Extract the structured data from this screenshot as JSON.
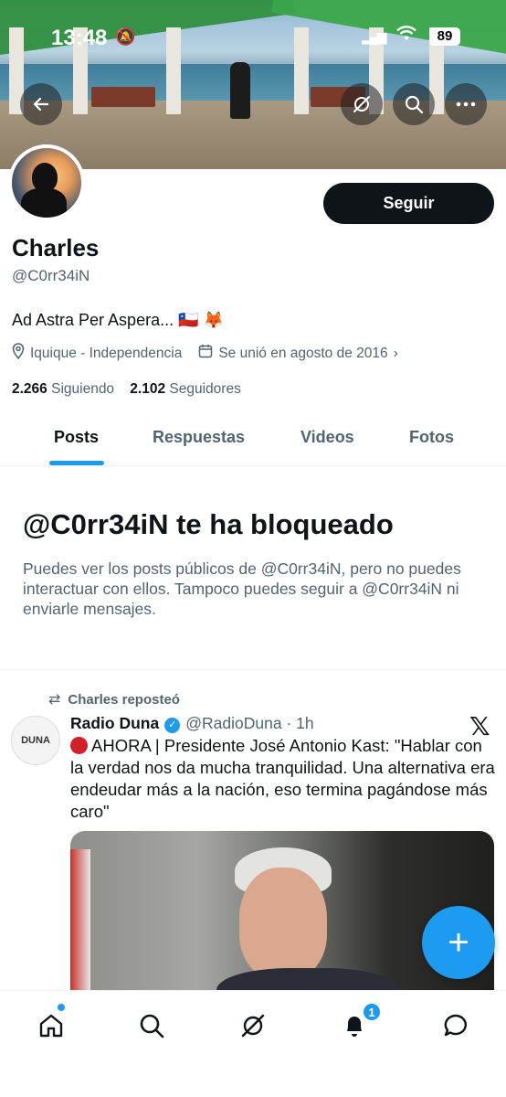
{
  "status_bar": {
    "time": "13:48",
    "battery": "89"
  },
  "profile": {
    "name": "Charles",
    "handle": "@C0rr34iN",
    "bio": "Ad Astra Per Aspera... 🇨🇱 🦊",
    "location": "Iquique - Independencia",
    "joined": "Se unió en agosto de 2016",
    "following_count": "2.266",
    "following_label": "Siguiendo",
    "followers_count": "2.102",
    "followers_label": "Seguidores",
    "follow_button": "Seguir"
  },
  "tabs": [
    "Posts",
    "Respuestas",
    "Videos",
    "Fotos"
  ],
  "active_tab": "Posts",
  "blocked": {
    "title": "@C0rr34iN te ha bloqueado",
    "text": "Puedes ver los posts públicos de @C0rr34iN, pero no puedes interactuar con ellos. Tampoco puedes seguir a @C0rr34iN ni enviarle mensajes."
  },
  "tweet": {
    "repost_label": "Charles reposteó",
    "avatar_text": "DUNA",
    "display_name": "Radio Duna",
    "handle": "@RadioDuna",
    "time": "· 1h",
    "text": "AHORA | Presidente José Antonio Kast: \"Hablar con la verdad nos da mucha tranquilidad. Una alternativa era endeudar más a la nación, eso termina pagándose más caro\""
  },
  "nav": {
    "notifications_count": "1"
  },
  "icons": {
    "back": "back-arrow-icon",
    "grok": "grok-icon",
    "search": "search-icon",
    "more": "more-icon",
    "location": "location-pin-icon",
    "calendar": "calendar-icon",
    "repost": "repost-icon",
    "verified": "verified-badge-icon",
    "x": "x-logo-icon",
    "compose": "plus-icon",
    "home": "home-icon",
    "notifications": "bell-icon",
    "messages": "messages-icon"
  },
  "colors": {
    "accent": "#1d9bf0",
    "text": "#0f1419",
    "muted": "#536471",
    "follow_bg": "#0f1419"
  }
}
